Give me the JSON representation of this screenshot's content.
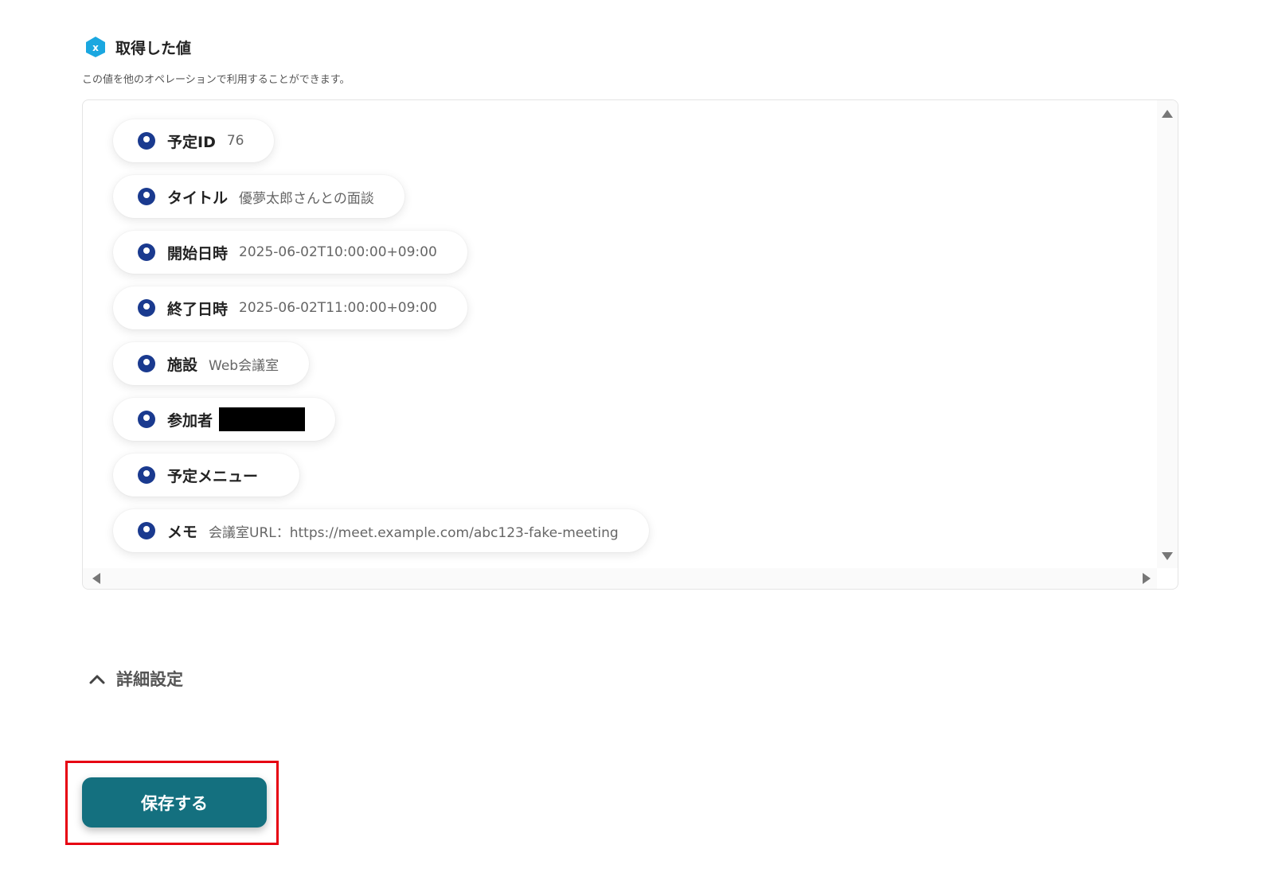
{
  "section": {
    "title": "取得した値",
    "description": "この値を他のオペレーションで利用することができます。"
  },
  "values": [
    {
      "label": "予定ID",
      "value": "76"
    },
    {
      "label": "タイトル",
      "value": "優夢太郎さんとの面談"
    },
    {
      "label": "開始日時",
      "value": "2025-06-02T10:00:00+09:00"
    },
    {
      "label": "終了日時",
      "value": "2025-06-02T11:00:00+09:00"
    },
    {
      "label": "施設",
      "value": "Web会議室"
    },
    {
      "label": "参加者",
      "value": ""
    },
    {
      "label": "予定メニュー",
      "value": ""
    },
    {
      "label": "メモ",
      "value": "会議室URL：https://meet.example.com/abc123-fake-meeting"
    }
  ],
  "advanced_settings": {
    "label": "詳細設定"
  },
  "save_button": {
    "label": "保存する"
  },
  "colors": {
    "accent": "#14707f",
    "chip_icon": "#1a3a8f",
    "section_icon": "#1aa7e0",
    "highlight": "#e60012"
  }
}
